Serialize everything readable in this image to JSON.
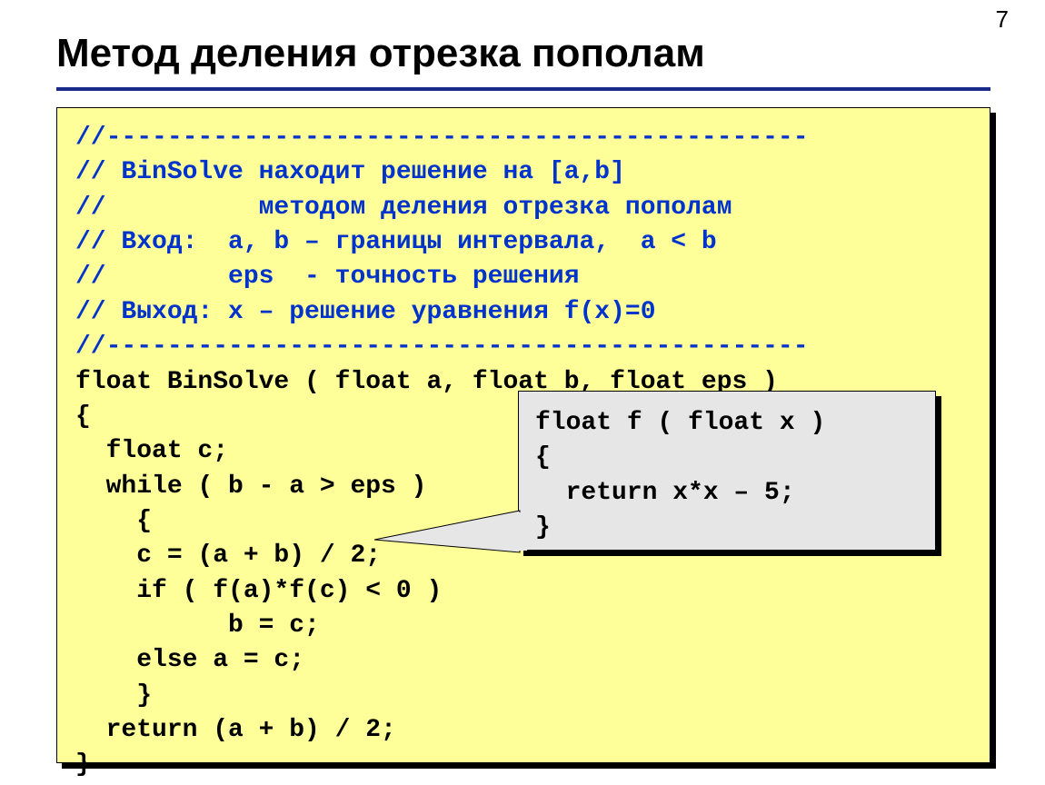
{
  "page_number": "7",
  "title": "Метод деления отрезка пополам",
  "code": {
    "l1": "//----------------------------------------------",
    "l2": "// BinSolve находит решение на [a,b]",
    "l3": "//          методом деления отрезка пополам",
    "l4": "// Вход:  a, b – границы интервала,  a < b",
    "l5": "//        eps  - точность решения",
    "l6": "// Выход: x – решение уравнения f(x)=0",
    "l7": "//----------------------------------------------",
    "l8": "float BinSolve ( float a, float b, float eps )",
    "l9": "{",
    "l10": "  float c;",
    "l11": "  while ( b - a > eps )",
    "l12": "    {",
    "l13": "    c = (a + b) / 2;",
    "l14": "    if ( f(a)*f(c) < 0 )",
    "l15": "          b = c;",
    "l16": "    else a = c;",
    "l17": "    }",
    "l18": "  return (a + b) / 2;",
    "l19": "}"
  },
  "callout": {
    "l1": "float f ( float x )",
    "l2": "{",
    "l3": "  return x*x – 5;",
    "l4": "}"
  }
}
